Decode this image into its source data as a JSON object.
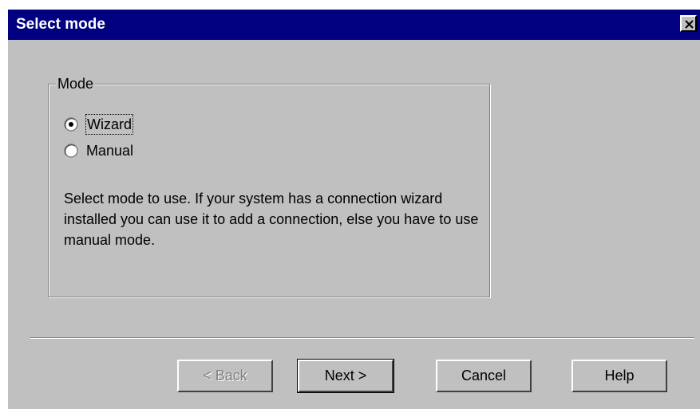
{
  "window": {
    "title": "Select mode"
  },
  "group": {
    "label": "Mode"
  },
  "mode_options": [
    {
      "label": "Wizard",
      "selected": true
    },
    {
      "label": "Manual",
      "selected": false
    }
  ],
  "description": "Select mode to use. If your system has a connection wizard installed you can use it to add a connection, else you have to use manual mode.",
  "buttons": {
    "back": "< Back",
    "next": "Next >",
    "cancel": "Cancel",
    "help": "Help"
  },
  "colors": {
    "titlebar": "#000080",
    "dialog_bg": "#c0c0c0"
  },
  "icons": {
    "close": "close-icon"
  }
}
